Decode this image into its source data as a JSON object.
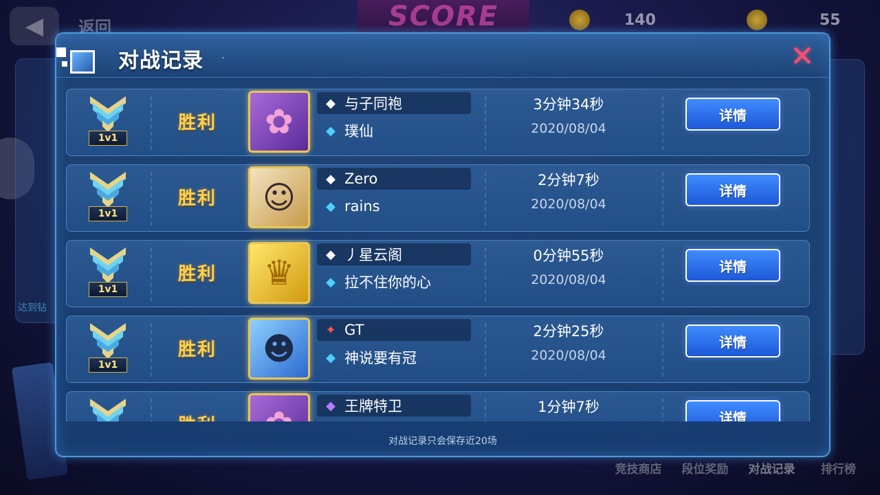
{
  "background": {
    "back_label": "返回",
    "score_sign": "SCORE",
    "currency_a": "140",
    "currency_b": "55",
    "left_panel_text": "达到钻",
    "bottom_nav": [
      "竞技商店",
      "段位奖励",
      "对战记录",
      "排行榜"
    ]
  },
  "modal": {
    "title": "对战记录",
    "close_symbol": "✕",
    "footer_note": "对战记录只会保存近20场",
    "detail_label": "详情",
    "records": [
      {
        "badge": "1v1",
        "result": "胜利",
        "name": "与子同袍",
        "name_icon": "◆",
        "server": "璞仙",
        "duration": "3分钟34秒",
        "date": "2020/08/04"
      },
      {
        "badge": "1v1",
        "result": "胜利",
        "name": "Zero",
        "name_icon": "◆",
        "server": "rains",
        "duration": "2分钟7秒",
        "date": "2020/08/04"
      },
      {
        "badge": "1v1",
        "result": "胜利",
        "name": "丿星云阁",
        "name_icon": "◆",
        "server": "拉不住你的心",
        "duration": "0分钟55秒",
        "date": "2020/08/04"
      },
      {
        "badge": "1v1",
        "result": "胜利",
        "name": "GT",
        "name_icon": "✦",
        "server": "神说要有冠",
        "duration": "2分钟25秒",
        "date": "2020/08/04"
      },
      {
        "badge": "",
        "result": "胜利",
        "name": "王牌特卫",
        "name_icon": "◆",
        "server": "",
        "duration": "1分钟7秒",
        "date": ""
      }
    ]
  }
}
